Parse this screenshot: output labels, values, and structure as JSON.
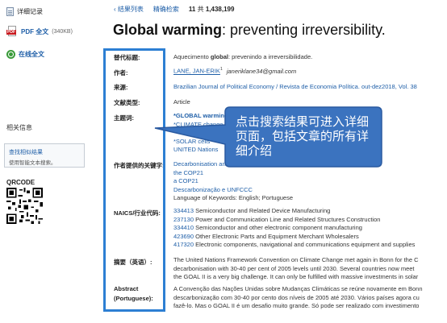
{
  "sidebar": {
    "detail_record": "详细记录",
    "pdf_label": "PDF 全文",
    "pdf_size": "(340KB)",
    "online_full_text": "在线全文",
    "related_info": "相关信息",
    "find_similar_title": "查找相似结果",
    "find_similar_desc": "使用智能文本搜索。",
    "qrcode": "QRCODE"
  },
  "header": {
    "back_to_results": "‹ 结果列表",
    "refine_search": "精确检索",
    "result_position": "11",
    "result_of": "共",
    "result_total": "1,438,199"
  },
  "article": {
    "title_bold": "Global warming",
    "title_rest": ": preventing irreversibility."
  },
  "fields": {
    "alt_title_label": "替代标题:",
    "alt_title_pre": "Aquecimento ",
    "alt_title_bold": "global",
    "alt_title_post": ": prevenindo a irreversibilidade.",
    "author_label": "作者:",
    "author_name": "LANE, JAN-ERIK",
    "author_sup": "1",
    "author_email": "janeriklane34@gmail.com",
    "source_label": "来源:",
    "source_value": "Brazilian Journal of Political Economy / Revista de Economia Política. out-dez2018, Vol. 38",
    "doctype_label": "文献类型:",
    "doctype_value": "Article",
    "subject_label": "主题词:",
    "subject_1": "*GLOBAL warming",
    "subject_2": "*CLIMATE change",
    "subject_3": "*SOLAR cells",
    "subject_4": "UNITED Nations",
    "author_kw_label": "作者提供的关键字:",
    "kw_1": "Decarbonisation and the UNFCCC",
    "kw_2": "the COP21",
    "kw_3": "a COP21",
    "kw_4": "Descarbonização e UNFCCC",
    "kw_lang": "Language of Keywords: English; Portuguese",
    "naics_label": "NAICS/行业代码:",
    "naics": [
      {
        "code": "334413",
        "desc": "Semiconductor and Related Device Manufacturing"
      },
      {
        "code": "237130",
        "desc": "Power and Communication Line and Related Structures Construction"
      },
      {
        "code": "334410",
        "desc": "Semiconductor and other electronic component manufacturing"
      },
      {
        "code": "423690",
        "desc": "Other Electronic Parts and Equipment Merchant Wholesalers"
      },
      {
        "code": "417320",
        "desc": "Electronic components, navigational and communications equipment and supplies"
      }
    ],
    "abstract_en_label": "摘要（英语）:",
    "abstract_en": [
      "The United Nations Framework Convention on Climate Change met again in Bonn for the C",
      "decarbonisation with 30-40 per cent of 2005 levels until 2030. Several countries now meet",
      "the GOAL II is a very big challenge. It can only be fulfilled with massive investments in solar"
    ],
    "abstract_pt_label_1": "Abstract",
    "abstract_pt_label_2": "(Portuguese):",
    "abstract_pt": [
      "A Convenção das Nações Unidas sobre Mudanças Climáticas se reúne novamente em Bonn",
      "descarbonização com 30-40 por cento dos níveis de 2005 até 2030. Vários países agora cu",
      "fazê-lo. Mas o GOAL II é um desafio muito grande. Só pode ser realizado com investimento"
    ]
  },
  "callout": {
    "text": "点击搜索结果可进入详细页面，包括文章的所有详细介绍"
  },
  "colors": {
    "link": "#1f5fa8",
    "highlight": "#2d7fd3",
    "callout_fill": "#3b73bf"
  }
}
